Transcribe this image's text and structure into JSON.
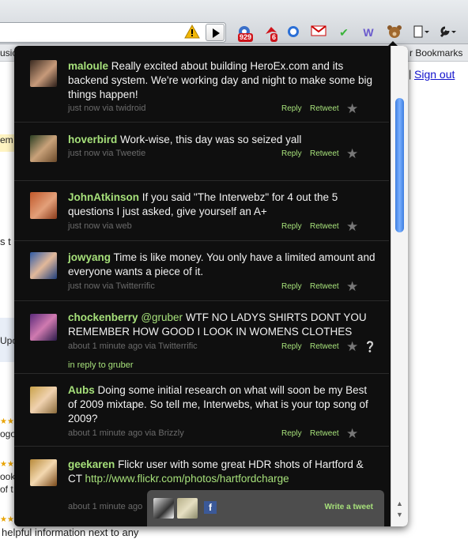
{
  "browser": {
    "extensions": [
      {
        "icon": "rss-feed-icon",
        "badge": "929"
      },
      {
        "icon": "bird-notifier-icon",
        "badge": "6"
      },
      {
        "icon": "phone-icon",
        "badge": ""
      },
      {
        "icon": "gmail-icon",
        "badge": ""
      },
      {
        "icon": "checkmark-icon",
        "badge": ""
      },
      {
        "icon": "w-extension-icon",
        "badge": ""
      },
      {
        "icon": "bear-chromed-bird-icon",
        "badge": ""
      }
    ]
  },
  "background_page": {
    "fragment_left_1": "usic",
    "bookmarks_label": "r Bookmarks",
    "sign_out": "Sign out",
    "sep": "|",
    "frag_em": "em",
    "frag_s_t": "s t",
    "frag_upd": "Upc",
    "frag_ogo": "ogo",
    "frag_ook": "ook",
    "frag_of": "of t",
    "footer_text": "helpful information next to any"
  },
  "popup": {
    "colors": {
      "background": "#0f0f0f",
      "accent": "#a6e07a",
      "meta": "#6b6b6b"
    },
    "tweets": [
      {
        "user": "maloule",
        "text": "Really excited about building HeroEx.com and its backend system. We're working day and night to make some big things happen!",
        "meta": "just now via twidroid",
        "reply": "Reply",
        "retweet": "Retweet"
      },
      {
        "user": "hoverbird",
        "text": "Work-wise, this day was so seized yall",
        "meta": "just now via Tweetie",
        "reply": "Reply",
        "retweet": "Retweet"
      },
      {
        "user": "JohnAtkinson",
        "text": "If you said \"The Interwebz\" for 4 out the 5 questions I just asked, give yourself an A+",
        "meta": "just now via web",
        "reply": "Reply",
        "retweet": "Retweet"
      },
      {
        "user": "jowyang",
        "text": "Time is like money. You only have a limited amount and everyone wants a piece of it.",
        "meta": "just now via Twitterrific",
        "reply": "Reply",
        "retweet": "Retweet"
      },
      {
        "user": "chockenberry",
        "mention": "@gruber",
        "text": "WTF NO LADYS SHIRTS DONT YOU REMEMBER HOW GOOD I LOOK IN WOMENS CLOTHES",
        "meta": "about 1 minute ago via Twitterrific",
        "reply": "Reply",
        "retweet": "Retweet",
        "in_reply_to": "in reply to gruber"
      },
      {
        "user": "Aubs",
        "text": "Doing some initial research on what will soon be my Best of 2009 mixtape. So tell me, Interwebs, what is your top song of 2009?",
        "meta": "about 1 minute ago via Brizzly",
        "reply": "Reply",
        "retweet": "Retweet"
      },
      {
        "user": "geekaren",
        "text": "Flickr user with some great HDR shots of Hartford & CT",
        "link": "http://www.flickr.com/photos/hartfordcharge",
        "meta": "about 1 minute ago"
      }
    ],
    "bottom": {
      "write_tweet": "Write a tweet",
      "facebook_glyph": "f"
    }
  }
}
